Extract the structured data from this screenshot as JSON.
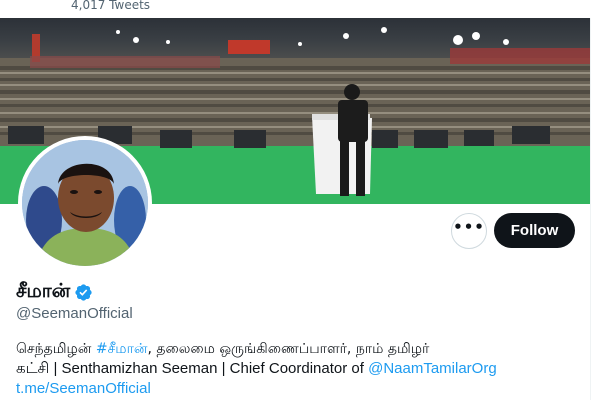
{
  "header": {
    "tweet_count": "4,017 Tweets"
  },
  "profile": {
    "display_name": "சீமான்",
    "verified": true,
    "handle": "@SeemanOfficial",
    "bio": {
      "part1": "செந்தமிழன் ",
      "hashtag": "#சீமான்",
      "part2": ", தலைமை ஒருங்கிணைப்பாளர், நாம் தமிழர்",
      "part3": "கட்சி | Senthamizhan Seeman | Chief Coordinator of ",
      "mention": "@NaamTamilarOrg",
      "url": "t.me/SeemanOfficial"
    }
  },
  "actions": {
    "more_label": "•••",
    "follow_label": "Follow"
  },
  "icons": {
    "more": "more-dots-icon",
    "verified": "verified-badge-icon"
  },
  "colors": {
    "accent": "#1d9bf0",
    "follow_bg": "#0f1419",
    "stage_green": "#2fb35b"
  }
}
